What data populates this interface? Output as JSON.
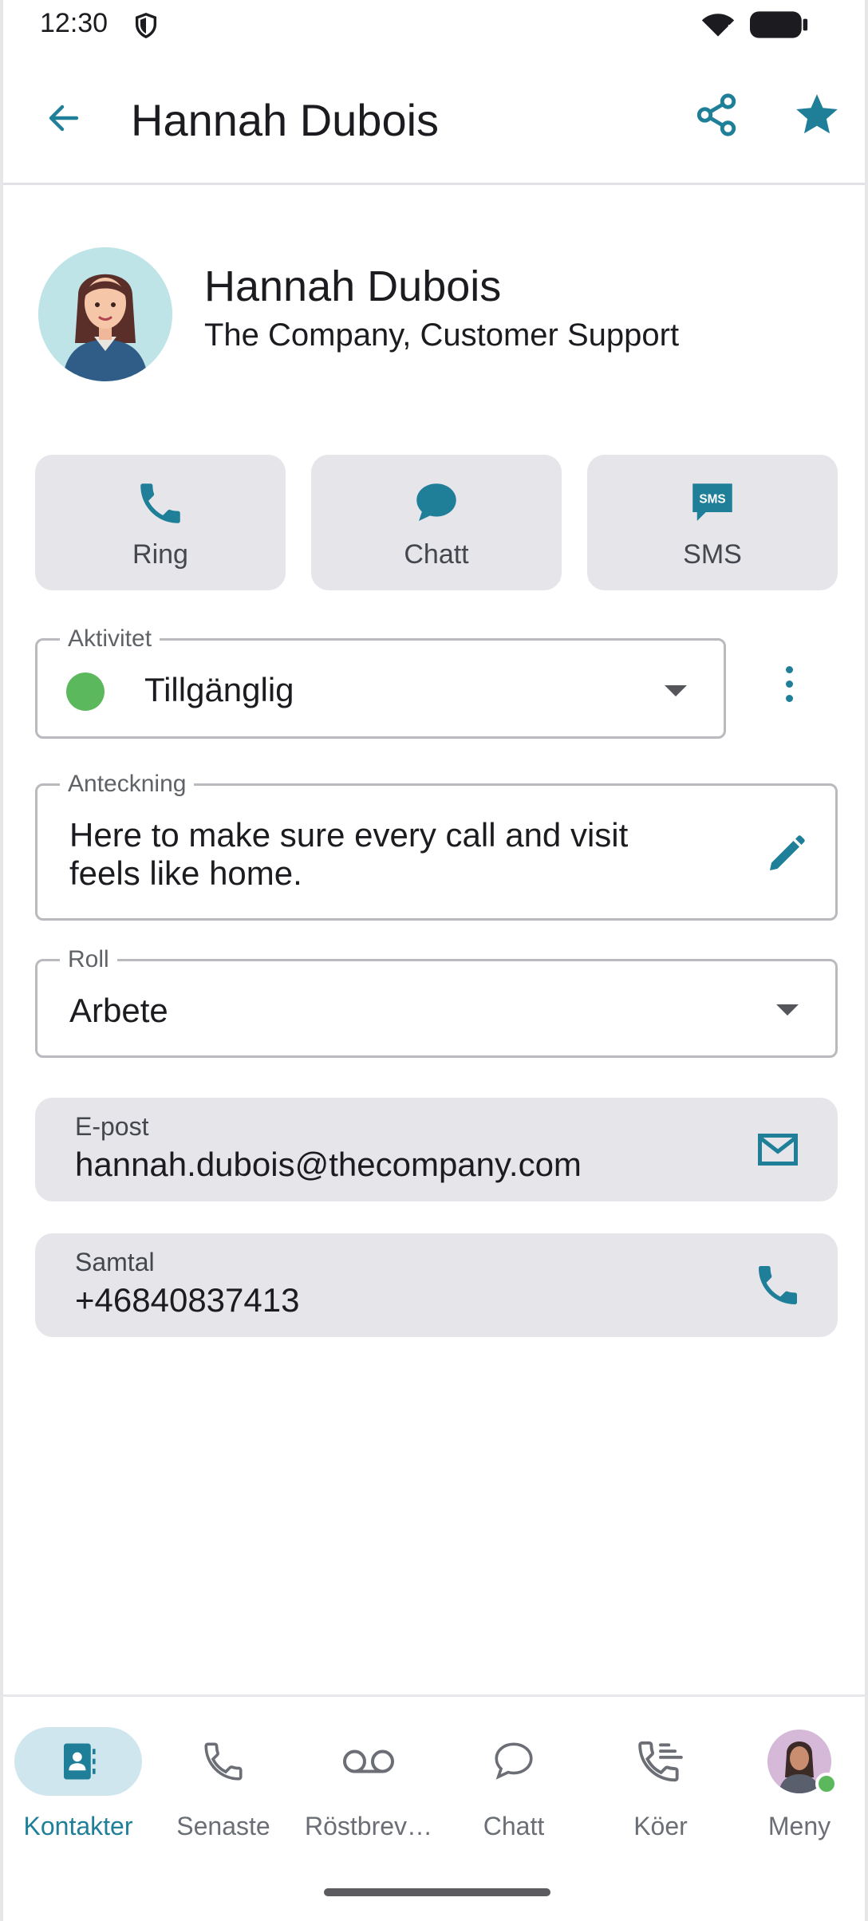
{
  "status_bar": {
    "time": "12:30"
  },
  "app_bar": {
    "title": "Hannah Dubois"
  },
  "profile": {
    "name": "Hannah Dubois",
    "subtitle": "The Company, Customer Support"
  },
  "actions": [
    {
      "label": "Ring",
      "icon": "phone-icon"
    },
    {
      "label": "Chatt",
      "icon": "chat-bubble-icon"
    },
    {
      "label": "SMS",
      "icon": "sms-icon",
      "icon_text": "SMS"
    }
  ],
  "activity": {
    "label": "Aktivitet",
    "value": "Tillgänglig",
    "status_color": "#5cb85c"
  },
  "note": {
    "label": "Anteckning",
    "line1": "Here to make sure every call and visit",
    "line2": "feels like home."
  },
  "role": {
    "label": "Roll",
    "value": "Arbete"
  },
  "email": {
    "label": "E-post",
    "value": "hannah.dubois@thecompany.com"
  },
  "phone": {
    "label": "Samtal",
    "value": "+46840837413"
  },
  "bottom_nav": [
    {
      "label": "Kontakter",
      "icon": "contacts-icon",
      "active": true
    },
    {
      "label": "Senaste",
      "icon": "phone-outline-icon"
    },
    {
      "label": "Röstbrev…",
      "icon": "voicemail-icon"
    },
    {
      "label": "Chatt",
      "icon": "chat-outline-icon"
    },
    {
      "label": "Köer",
      "icon": "queue-call-icon"
    },
    {
      "label": "Meny",
      "icon": "user-avatar"
    }
  ],
  "colors": {
    "accent": "#1f7f99",
    "card_bg": "#e5e5ea",
    "available": "#5cb85c"
  }
}
